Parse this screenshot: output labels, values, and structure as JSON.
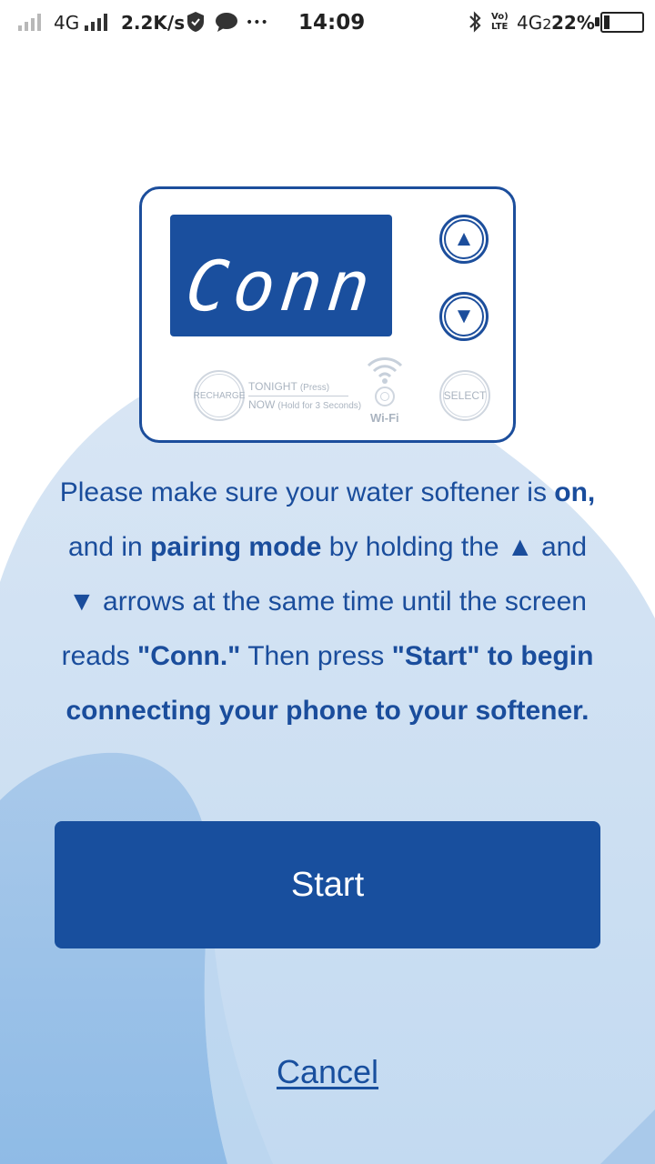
{
  "status_bar": {
    "network_1": "4G",
    "speed": "2.2K/s",
    "more": "•••",
    "time": "14:09",
    "volte": "Vo) LTE",
    "network_2": "4G",
    "network_2_sub": "2",
    "battery": "22%"
  },
  "device": {
    "display_text": "Conn",
    "up_arrow": "▲",
    "down_arrow": "▼",
    "recharge_label": "RECHARGE",
    "tonight_label": "TONIGHT",
    "tonight_hint": "(Press)",
    "now_label": "NOW",
    "now_hint": "(Hold for 3 Seconds)",
    "wifi_label": "Wi-Fi",
    "select_label": "SELECT"
  },
  "instructions": {
    "t1": "Please make sure your water softener is ",
    "b1": "on,",
    "t2": " and in ",
    "b2": "pairing mode",
    "t3": " by holding the ▲ and ▼ arrows at the same time until the screen reads ",
    "b3": "\"Conn.\"",
    "t4": " Then press ",
    "b4": "\"Start\"",
    "b5": " to begin connecting your phone to your softener."
  },
  "actions": {
    "start_label": "Start",
    "cancel_label": "Cancel"
  },
  "colors": {
    "primary": "#184f9e",
    "blob_light": "#cfe0f2",
    "blob_mid": "#a7c8ea"
  }
}
